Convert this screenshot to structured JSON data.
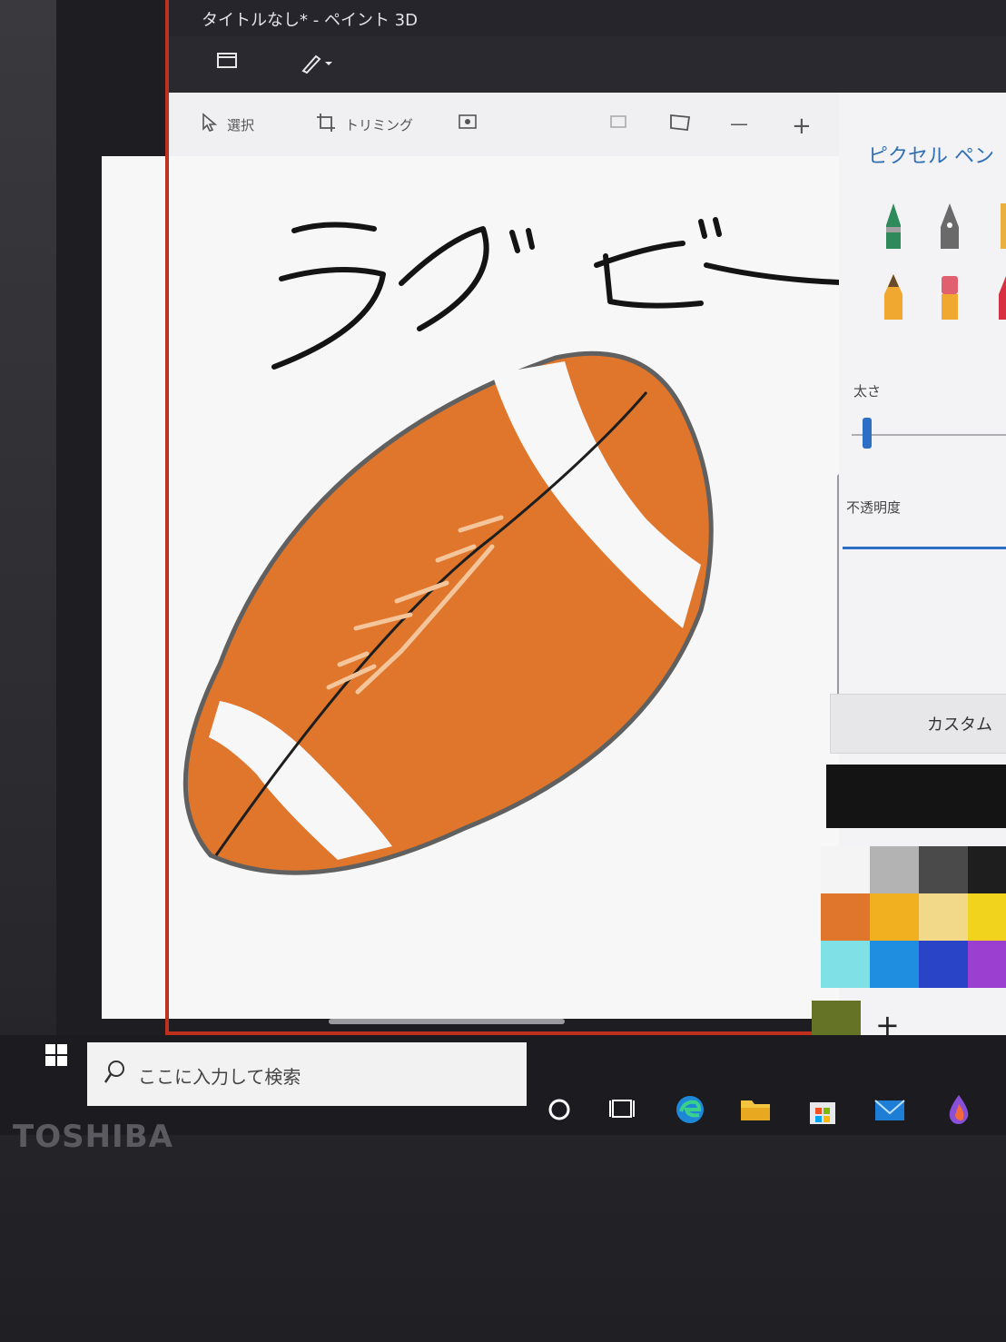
{
  "window": {
    "title": "タイトルなし* - ペイント 3D"
  },
  "toolbar": {
    "select_label": "選択",
    "crop_label": "トリミング"
  },
  "canvas": {
    "drawn_text": "ラグビー"
  },
  "panel": {
    "title": "ピクセル ペン",
    "thickness_label": "太さ",
    "opacity_label": "不透明度",
    "custom_label": "カスタム",
    "thickness_level": 0.1
  },
  "palette": {
    "swatches": [
      "#f4f4f4",
      "#b3b3b3",
      "#4a4a4a",
      "#1e1e1e",
      "#e0762b",
      "#f0b020",
      "#f2d98a",
      "#f1d21d",
      "#7fe0e6",
      "#1f8ee0",
      "#2a44c8",
      "#9a3fd0"
    ],
    "extra_swatch": "#657327",
    "selected_color": "#141414"
  },
  "taskbar": {
    "search_placeholder": "ここに入力して検索"
  },
  "brand": "TOSHIBA"
}
